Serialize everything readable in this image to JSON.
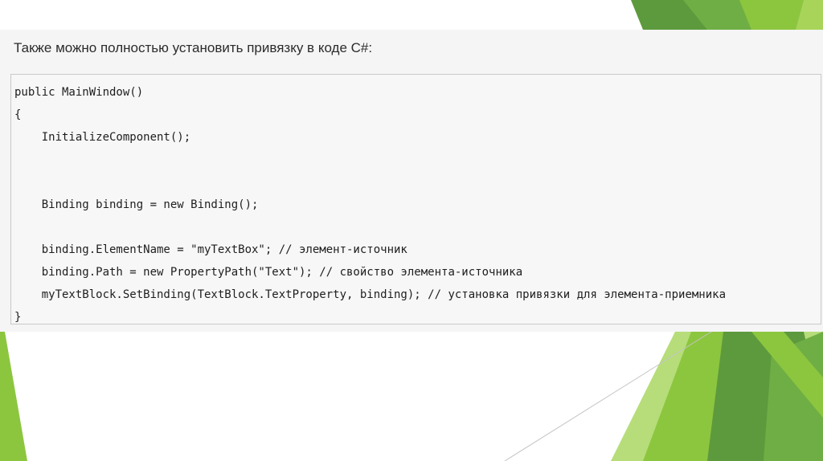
{
  "slide": {
    "intro": "Также можно полностью установить привязку в коде C#:"
  },
  "code": {
    "lines": [
      "public MainWindow()",
      "{",
      "    InitializeComponent();",
      "",
      "",
      "    Binding binding = new Binding();",
      "",
      "    binding.ElementName = \"myTextBox\"; // элемент-источник",
      "    binding.Path = new PropertyPath(\"Text\"); // свойство элемента-источника",
      "    myTextBlock.SetBinding(TextBlock.TextProperty, binding); // установка привязки для элемента-приемника",
      "}"
    ]
  },
  "theme": {
    "accent_dark": "#4e8f3a",
    "accent_mid": "#6fb043",
    "accent_light": "#8cc63f",
    "accent_pale": "#b6dd7a"
  }
}
